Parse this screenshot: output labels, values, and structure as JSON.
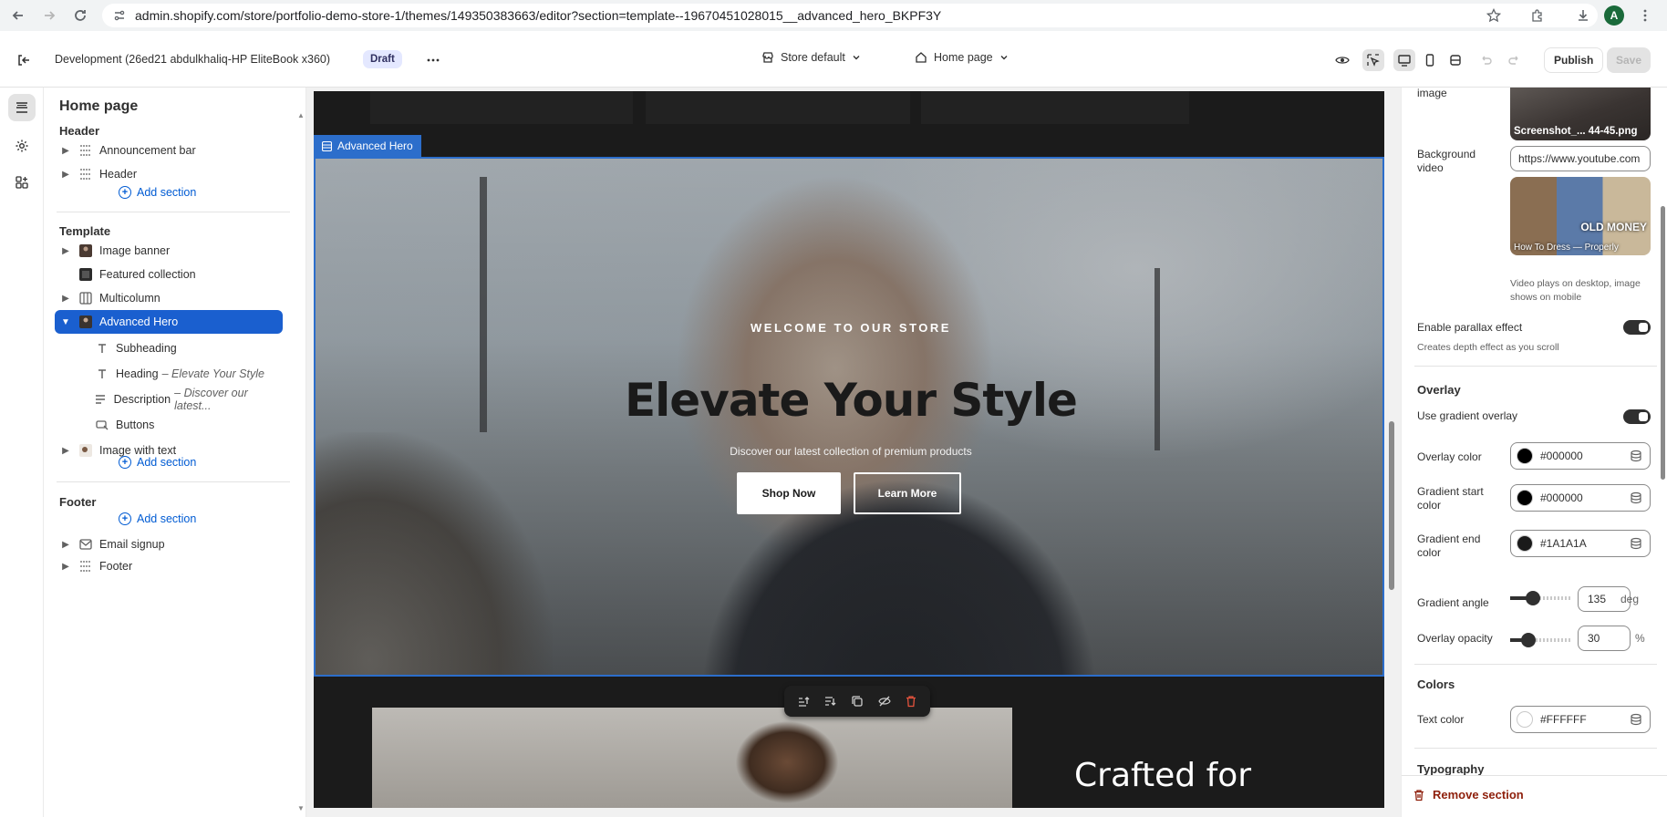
{
  "browser": {
    "url": "admin.shopify.com/store/portfolio-demo-store-1/themes/149350383663/editor?section=template--19670451028015__advanced_hero_BKPF3Y",
    "profile_initial": "A"
  },
  "topbar": {
    "store_name": "Development (26ed21 abdulkhaliq-HP EliteBook x360)",
    "status_badge": "Draft",
    "theme_selector": "Store default",
    "page_selector": "Home page",
    "publish_label": "Publish",
    "save_label": "Save"
  },
  "sidebar": {
    "title": "Home page",
    "header_group": {
      "title": "Header",
      "items": [
        "Announcement bar",
        "Header"
      ],
      "add_label": "Add section"
    },
    "template_group": {
      "title": "Template",
      "items": [
        "Image banner",
        "Featured collection",
        "Multicolumn",
        "Advanced Hero",
        "Image with text"
      ],
      "blocks": [
        {
          "label": "Subheading",
          "detail": ""
        },
        {
          "label": "Heading",
          "detail": "– Elevate Your Style"
        },
        {
          "label": "Description",
          "detail": "– Discover our latest..."
        },
        {
          "label": "Buttons",
          "detail": ""
        }
      ],
      "add_label": "Add section"
    },
    "footer_group": {
      "title": "Footer",
      "items": [
        "Email signup",
        "Footer"
      ],
      "add_label": "Add section"
    }
  },
  "preview": {
    "section_label": "Advanced Hero",
    "hero": {
      "subheading": "WELCOME TO OUR STORE",
      "heading": "Elevate Your Style",
      "description": "Discover our latest collection of premium products",
      "button_primary": "Shop Now",
      "button_secondary": "Learn More"
    },
    "lower_heading": "Crafted for"
  },
  "settings": {
    "bg_image_label": "Background image",
    "bg_image_caption": "Screenshot_... 44-45.png",
    "bg_video_label": "Background video",
    "bg_video_value": "https://www.youtube.com",
    "bg_video_thumb_text": "OLD MONEY",
    "bg_video_thumb_caption": "How To Dress — Properly",
    "bg_video_hint": "Video plays on desktop, image shows on mobile",
    "parallax_label": "Enable parallax effect",
    "parallax_hint": "Creates depth effect as you scroll",
    "overlay_head": "Overlay",
    "gradient_overlay_label": "Use gradient overlay",
    "overlay_color_label": "Overlay color",
    "overlay_color_value": "#000000",
    "grad_start_label": "Gradient start color",
    "grad_start_value": "#000000",
    "grad_end_label": "Gradient end color",
    "grad_end_value": "#1A1A1A",
    "grad_angle_label": "Gradient angle",
    "grad_angle_value": "135",
    "grad_angle_unit": "deg",
    "grad_angle_fraction": 0.37,
    "overlay_opacity_label": "Overlay opacity",
    "overlay_opacity_value": "30",
    "overlay_opacity_unit": "%",
    "overlay_opacity_fraction": 0.3,
    "colors_head": "Colors",
    "text_color_label": "Text color",
    "text_color_value": "#FFFFFF",
    "typography_head": "Typography",
    "remove_label": "Remove section"
  },
  "colors": {
    "accent": "#1a5fcf",
    "selection_blue": "#2c6ecb",
    "remove_red": "#8e1f0b"
  }
}
